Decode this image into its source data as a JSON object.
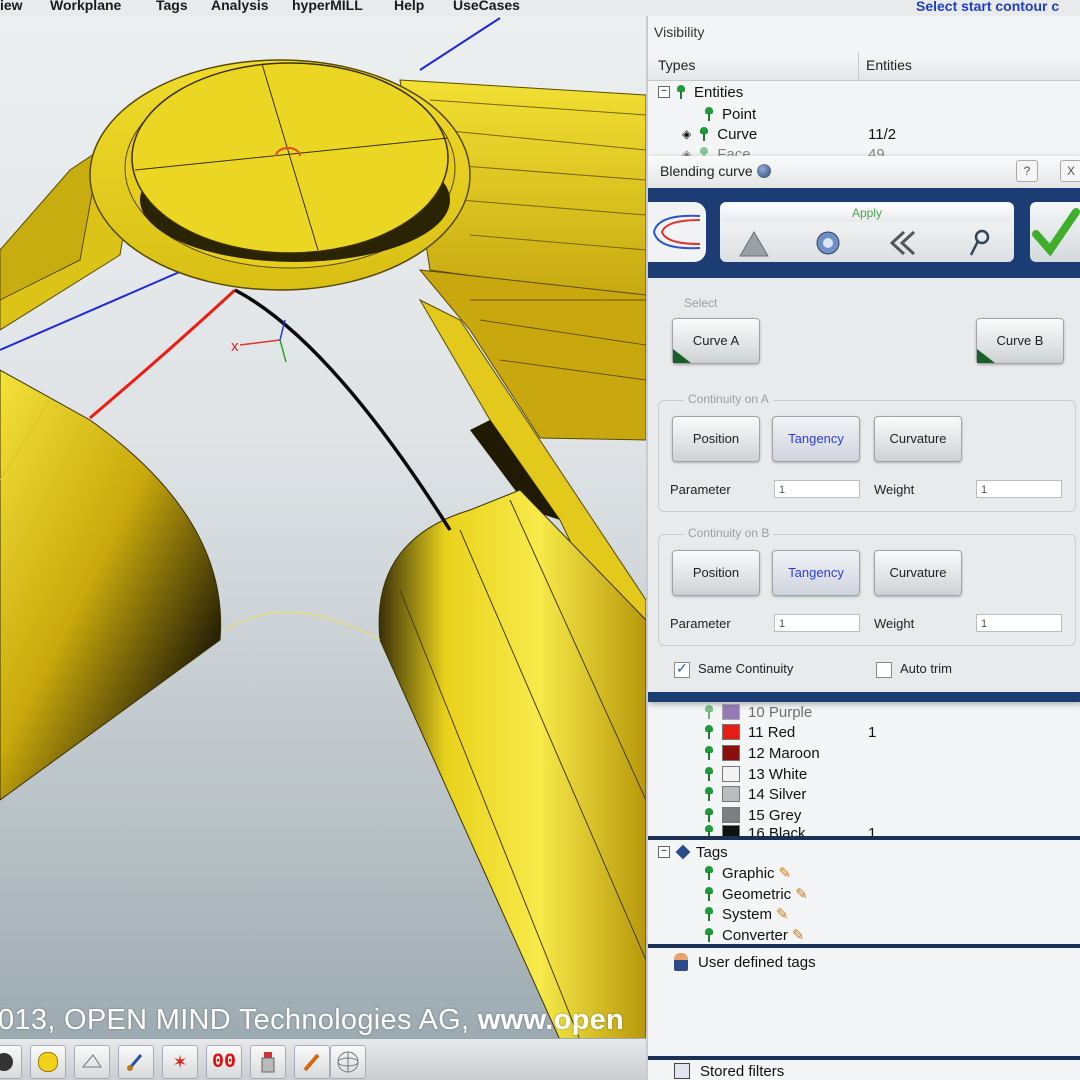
{
  "menu": {
    "items": [
      "iew",
      "Workplane",
      "Tags",
      "Analysis",
      "hyperMILL",
      "Help",
      "UseCases"
    ],
    "status_prompt": "Select start contour c"
  },
  "viewport": {
    "copyright_text": "013, OPEN MIND Technologies AG, ",
    "copyright_url": "www.open",
    "axis_label": "x",
    "toolbar_icons": [
      "shading-icon",
      "light-icon",
      "grid-plane-icon",
      "brush-icon",
      "star-icon",
      "counter-icon",
      "bottle-icon",
      "pencil-icon",
      "sphere-icon"
    ],
    "toolbar_counter": "00"
  },
  "visibility": {
    "title": "Visibility",
    "columns": [
      "Types",
      "Entities"
    ],
    "entities_label": "Entities",
    "rows": [
      {
        "label": "Point",
        "count": ""
      },
      {
        "label": "Curve",
        "count": "11/2"
      },
      {
        "label": "Face",
        "count": "49"
      }
    ]
  },
  "dialog": {
    "title": "Blending curve",
    "help": "?",
    "close": "X",
    "apply_label": "Apply",
    "select_label": "Select",
    "curve_a": "Curve A",
    "curve_b": "Curve B",
    "continuity_a_label": "Continuity on A",
    "continuity_b_label": "Continuity on B",
    "position": "Position",
    "tangency": "Tangency",
    "curvature": "Curvature",
    "parameter_label": "Parameter",
    "weight_label": "Weight",
    "param_a": "1",
    "weight_a": "1",
    "param_b": "1",
    "weight_b": "1",
    "same_continuity": "Same Continuity",
    "auto_trim": "Auto trim",
    "same_continuity_checked": true,
    "auto_trim_checked": false
  },
  "colors": {
    "rows": [
      {
        "label": "10 Purple",
        "swatch": "#5a2a8a",
        "count": ""
      },
      {
        "label": "11 Red",
        "swatch": "#e51d14",
        "count": "1"
      },
      {
        "label": "12 Maroon",
        "swatch": "#8a1010",
        "count": ""
      },
      {
        "label": "13 White",
        "swatch": "#f2f2f2",
        "count": ""
      },
      {
        "label": "14 Silver",
        "swatch": "#b9bcc0",
        "count": ""
      },
      {
        "label": "15 Grey",
        "swatch": "#7b7f84",
        "count": ""
      },
      {
        "label": "16 Black",
        "swatch": "#111111",
        "count": "1"
      }
    ]
  },
  "tags": {
    "title": "Tags",
    "items": [
      "Graphic",
      "Geometric",
      "System",
      "Converter"
    ]
  },
  "user_defined_tags": "User defined tags",
  "stored_filters": "Stored filters",
  "accent": {
    "dialog_band": "#1c3c74",
    "model_yellow": "#e8d21a",
    "status_blue": "#1f3fc2"
  }
}
